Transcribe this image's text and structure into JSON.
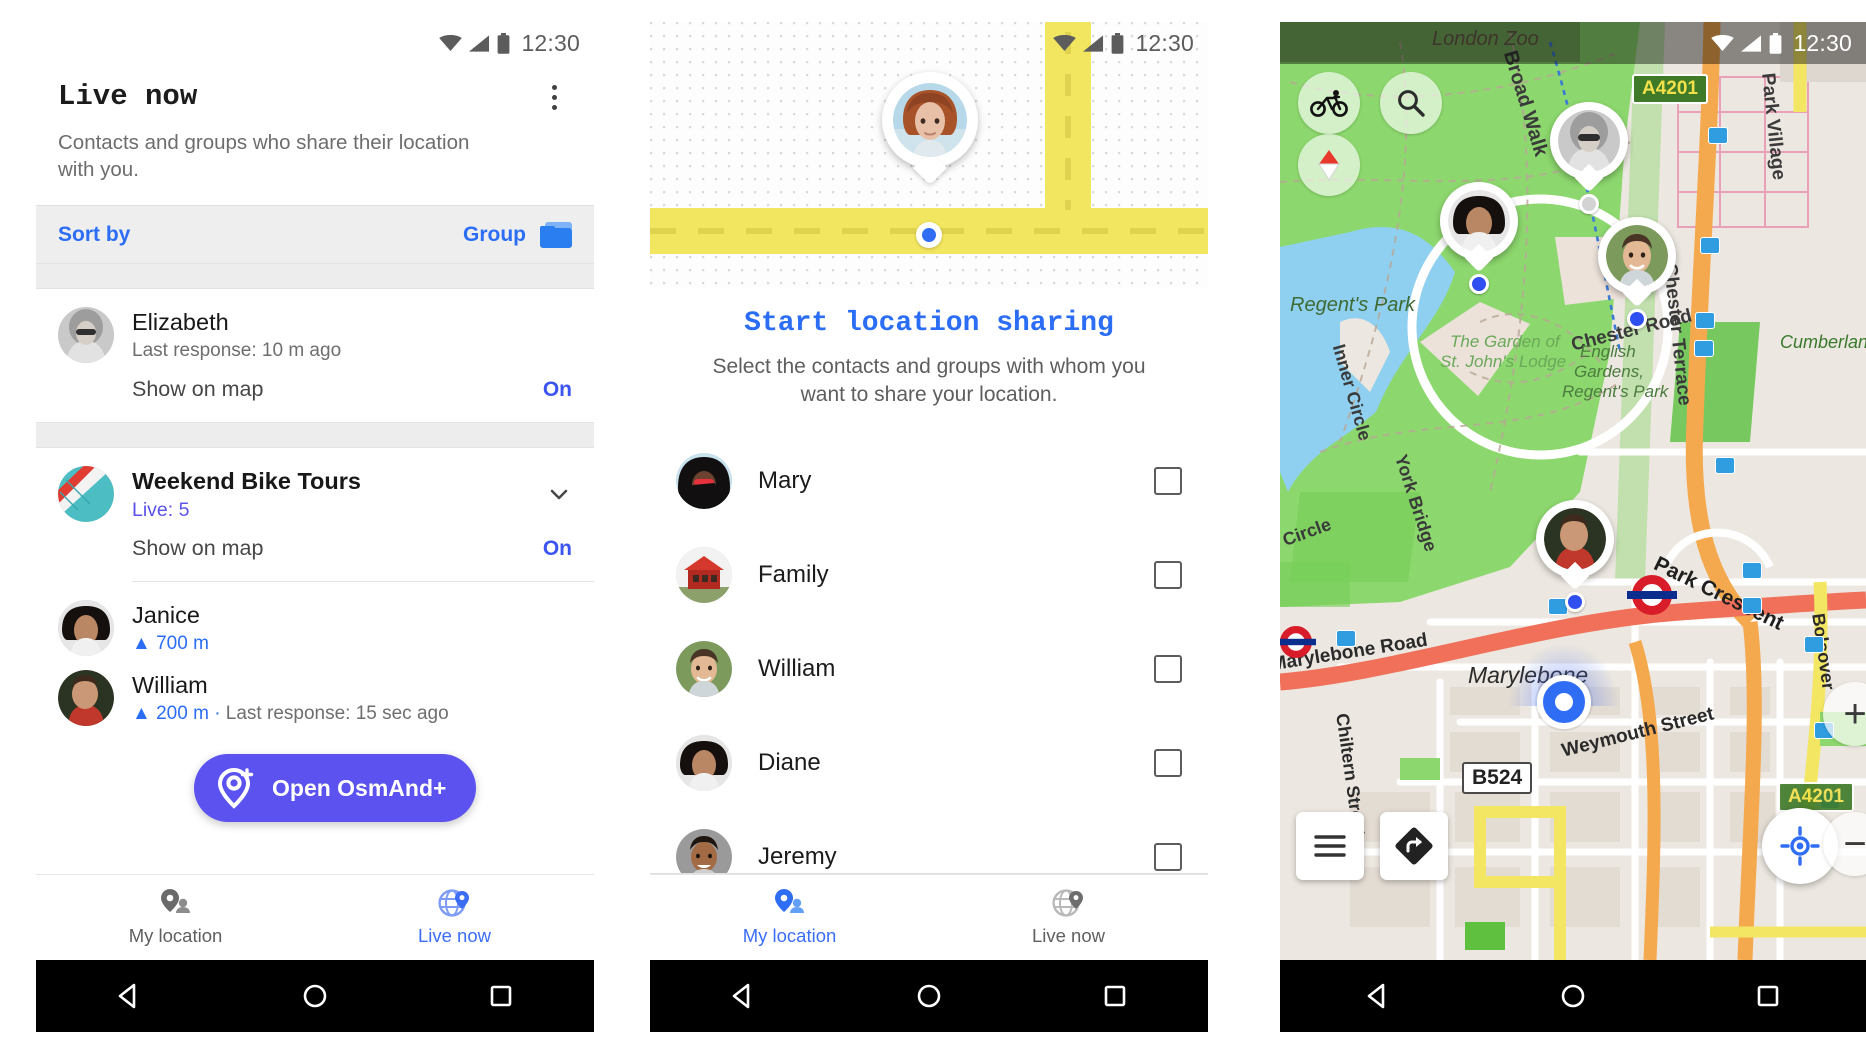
{
  "status_bar": {
    "time": "12:30",
    "icons": [
      "wifi-icon",
      "signal-icon",
      "battery-icon"
    ]
  },
  "colors": {
    "accent_blue": "#2b6ef5",
    "brand_purple": "#5b52ef",
    "live_purple": "#5b53e8",
    "road_yellow": "#f2e55f",
    "map_green": "#8fd86a",
    "inactive_gray": "#5f5f5f"
  },
  "panel1": {
    "title": "Live now",
    "subtitle": "Contacts and groups who share their location with you.",
    "overflow_menu": "kebab-menu-icon",
    "sort": {
      "label": "Sort by",
      "value": "Group",
      "icon": "folder-icon"
    },
    "items": [
      {
        "name": "Elizabeth",
        "subtitle": "Last response: 10 m ago",
        "avatar": "elizabeth-avatar",
        "show_on_map_label": "Show on map",
        "show_on_map_value": "On"
      },
      {
        "name": "Weekend Bike Tours",
        "subtitle": "Live: 5",
        "avatar": "bike-group-avatar",
        "is_group": true,
        "expand_icon": "chevron-down-icon",
        "show_on_map_label": "Show on map",
        "show_on_map_value": "On",
        "members": [
          {
            "name": "Janice",
            "distance": "700 m",
            "avatar": "janice-avatar"
          },
          {
            "name": "William",
            "distance": "200 m",
            "subtitle": "Last response: 15 sec ago",
            "avatar": "william-avatar"
          }
        ]
      }
    ],
    "fab": {
      "label": "Open OsmAnd+",
      "icon": "osmand-plus-icon"
    },
    "bottom_nav": [
      {
        "label": "My location",
        "icon": "my-location-pin-icon",
        "active": false
      },
      {
        "label": "Live now",
        "icon": "live-globe-icon",
        "active": true
      }
    ]
  },
  "panel2": {
    "hero": {
      "avatar": "hero-avatar",
      "pin_dot": "location-dot"
    },
    "title": "Start location sharing",
    "subtitle": "Select the contacts and groups with whom you want to share your location.",
    "contacts": [
      {
        "name": "Mary",
        "avatar": "mary-avatar",
        "checked": false
      },
      {
        "name": "Family",
        "avatar": "family-avatar",
        "checked": false
      },
      {
        "name": "William",
        "avatar": "william-avatar",
        "checked": false
      },
      {
        "name": "Diane",
        "avatar": "diane-avatar",
        "checked": false
      },
      {
        "name": "Jeremy",
        "avatar": "jeremy-avatar",
        "checked": false
      }
    ],
    "bottom_nav": [
      {
        "label": "My location",
        "icon": "my-location-pin-icon",
        "active": true
      },
      {
        "label": "Live now",
        "icon": "live-globe-icon",
        "active": false
      }
    ]
  },
  "panel3": {
    "controls": {
      "bike": "bicycle-profile-icon",
      "search": "search-icon",
      "compass": "compass-icon",
      "menu": "hamburger-menu-icon",
      "directions": "directions-turn-icon",
      "my_location": "center-my-location-icon",
      "zoom_in": "+",
      "zoom_out": "−"
    },
    "labels": [
      "London Zoo",
      "Broad Walk",
      "Regent's Park",
      "The Garden of",
      "St. John's Lodge",
      "Chester Road",
      "Inner Circle",
      "York Bridge",
      "Circle",
      "English",
      "Gardens,",
      "Regent's Park",
      "Chester Terrace",
      "Park Village",
      "Cumberland",
      "Park Crescent",
      "Marylebone",
      "Marylebone Road",
      "Chiltern Street",
      "Weymouth Street",
      "Bolsover"
    ],
    "road_shields": [
      "A4201",
      "B524"
    ],
    "friend_pins": [
      "elizabeth-map-pin",
      "janice-map-pin",
      "william-map-pin",
      "jeremy-map-pin"
    ]
  },
  "android_nav": {
    "back": "back-triangle-icon",
    "home": "home-circle-icon",
    "recents": "recents-square-icon"
  }
}
